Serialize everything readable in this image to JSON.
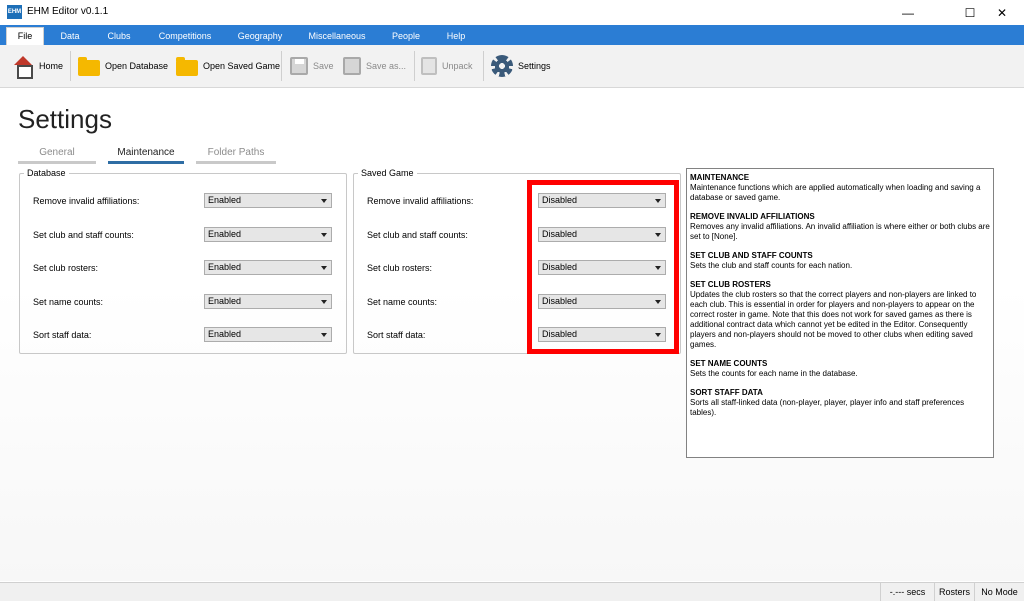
{
  "window": {
    "title": "EHM Editor v0.1.1",
    "app_icon_text": "EHM"
  },
  "menu": {
    "tabs": [
      "File",
      "Data",
      "Clubs",
      "Competitions",
      "Geography",
      "Miscellaneous",
      "People",
      "Help"
    ],
    "active": "File"
  },
  "toolbar": {
    "home": "Home",
    "open_database": "Open Database",
    "open_saved_game": "Open Saved Game",
    "save": "Save",
    "save_as": "Save as...",
    "unpack": "Unpack",
    "settings": "Settings"
  },
  "page": {
    "title": "Settings",
    "subtabs": [
      "General",
      "Maintenance",
      "Folder Paths"
    ],
    "active_subtab": "Maintenance"
  },
  "database": {
    "legend": "Database",
    "rows": [
      {
        "label": "Remove invalid affiliations:",
        "value": "Enabled"
      },
      {
        "label": "Set club and staff counts:",
        "value": "Enabled"
      },
      {
        "label": "Set club rosters:",
        "value": "Enabled"
      },
      {
        "label": "Set name counts:",
        "value": "Enabled"
      },
      {
        "label": "Sort staff data:",
        "value": "Enabled"
      }
    ]
  },
  "saved_game": {
    "legend": "Saved Game",
    "rows": [
      {
        "label": "Remove invalid affiliations:",
        "value": "Disabled"
      },
      {
        "label": "Set club and staff counts:",
        "value": "Disabled"
      },
      {
        "label": "Set club rosters:",
        "value": "Disabled"
      },
      {
        "label": "Set name counts:",
        "value": "Disabled"
      },
      {
        "label": "Sort staff data:",
        "value": "Disabled"
      }
    ]
  },
  "help": [
    {
      "heading": "MAINTENANCE",
      "body": "Maintenance functions which are applied automatically when loading and saving a database or saved game."
    },
    {
      "heading": "REMOVE INVALID AFFILIATIONS",
      "body": "Removes any invalid affiliations. An invalid affiliation is where either or both clubs are set to [None]."
    },
    {
      "heading": "SET CLUB AND STAFF COUNTS",
      "body": "Sets the club and staff counts for each nation."
    },
    {
      "heading": "SET CLUB ROSTERS",
      "body": "Updates the club rosters so that the correct players and non-players are linked to each club. This is essential in order for players and non-players to appear on the correct roster in game. Note that this does not work for saved games as there is additional contract data which cannot yet be edited in the Editor. Consequently players and non-players should not be moved to other clubs when editing saved games."
    },
    {
      "heading": "SET NAME COUNTS",
      "body": "Sets the counts for each name in the database."
    },
    {
      "heading": "SORT STAFF DATA",
      "body": "Sorts all staff-linked data (non-player, player, player info and staff preferences tables)."
    }
  ],
  "status": {
    "timer": "-.--- secs",
    "mode_a": "Rosters",
    "mode_b": "No Mode"
  },
  "colors": {
    "menu_bar": "#2b7dd4",
    "highlight": "#ff0000",
    "active_underline": "#2e6da4"
  }
}
